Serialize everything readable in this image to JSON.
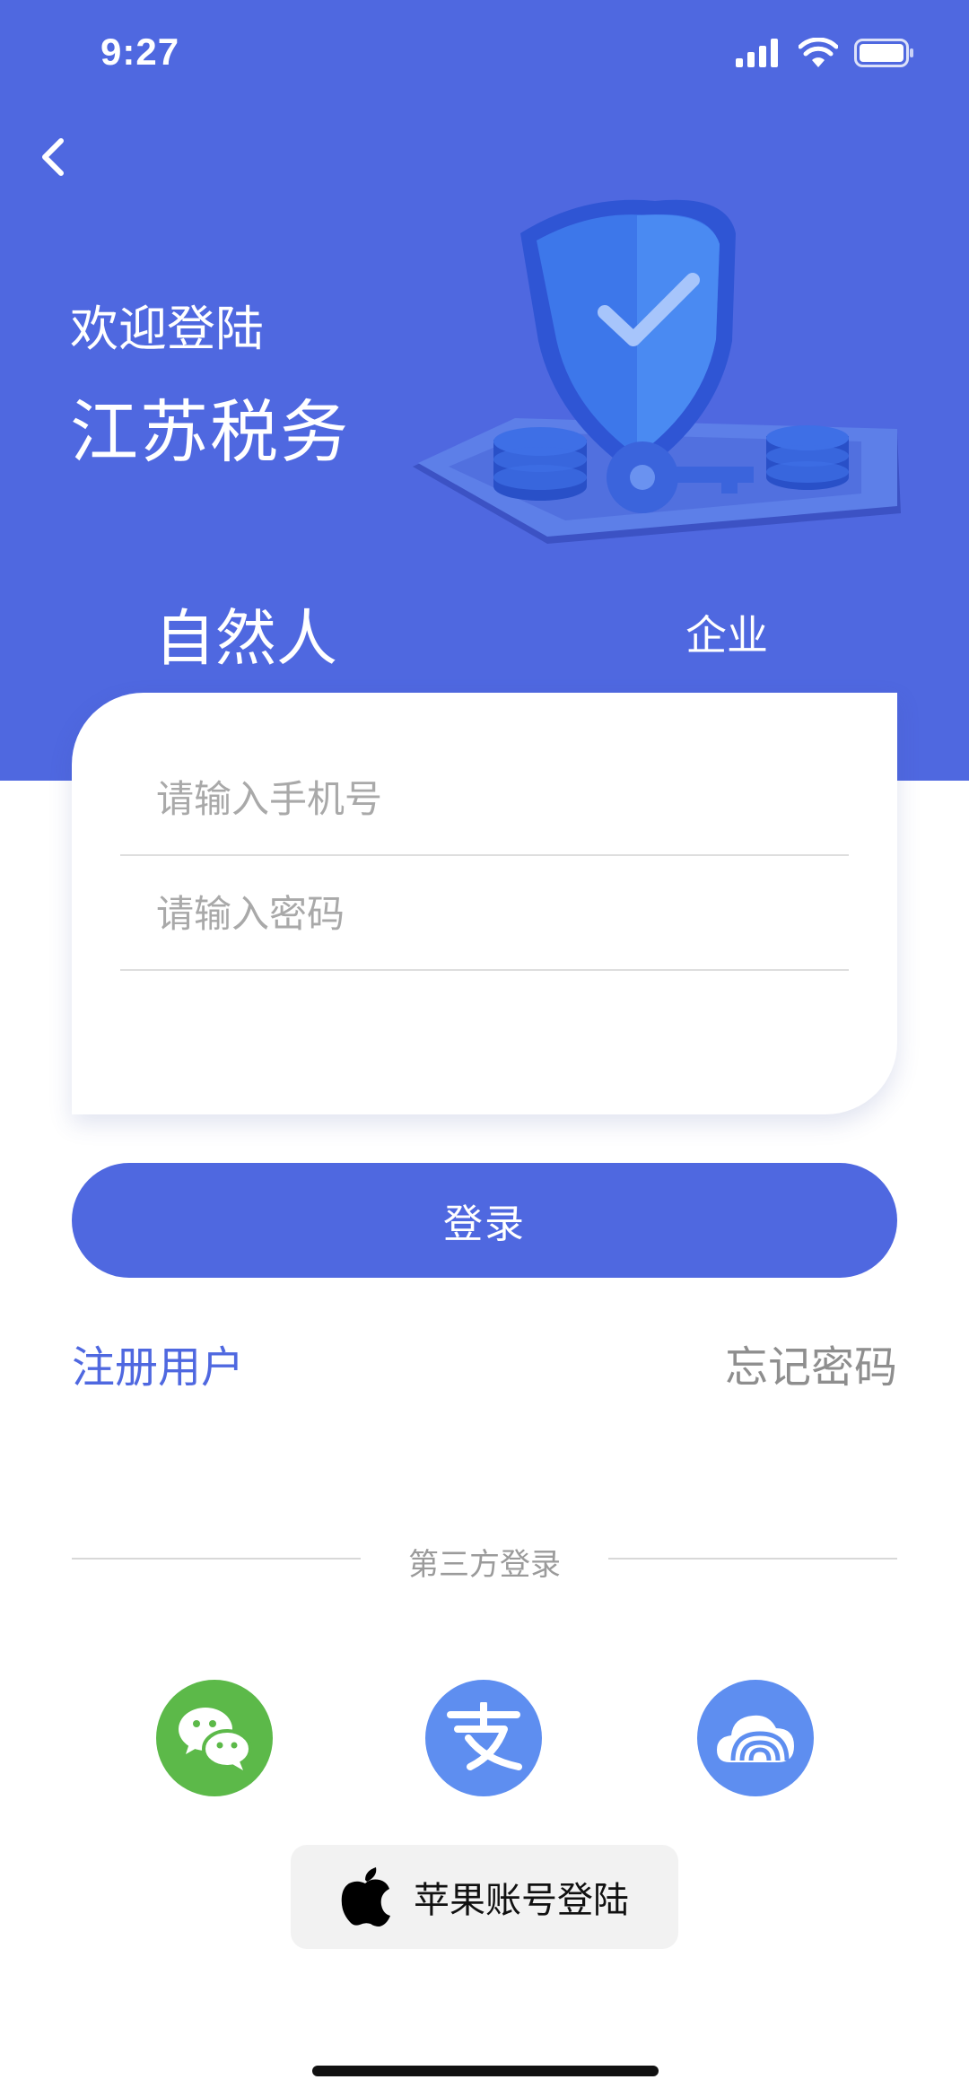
{
  "status_bar": {
    "time": "9:27"
  },
  "header": {
    "welcome": "欢迎登陆",
    "app_name": "江苏税务"
  },
  "tabs": [
    {
      "label": "自然人",
      "selected": true
    },
    {
      "label": "企业",
      "selected": false
    }
  ],
  "form": {
    "phone_placeholder": "请输入手机号",
    "password_placeholder": "请输入密码",
    "phone_value": "",
    "password_value": ""
  },
  "login_button": "登录",
  "links": {
    "register": "注册用户",
    "forgot_password": "忘记密码"
  },
  "third_party": {
    "divider_label": "第三方登录",
    "providers": [
      {
        "icon": "wechat-icon",
        "color": "#5cb949"
      },
      {
        "icon": "alipay-icon",
        "color": "#5e8ef0"
      },
      {
        "icon": "cloud-icon",
        "color": "#5e8ef0"
      }
    ]
  },
  "apple_login": {
    "label": "苹果账号登陆",
    "icon": "apple-icon"
  },
  "colors": {
    "primary": "#4f68e0",
    "wechat": "#5cb949",
    "alipay": "#5e8ef0",
    "link_gray": "#8e8e8e"
  }
}
